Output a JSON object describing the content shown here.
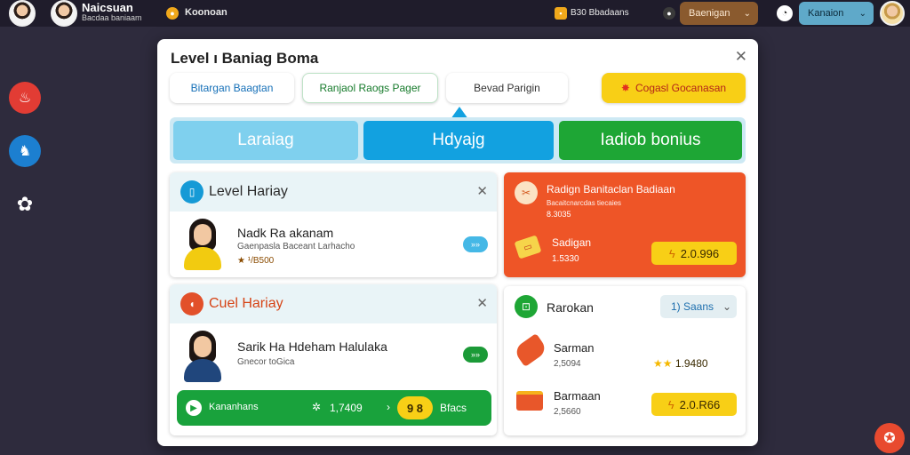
{
  "topbar": {
    "user_name": "Naicsuan",
    "user_sub": "Bacdaa baniaam",
    "app_label": "Koonoan",
    "currency_text": "B30 Bbadaans",
    "dropdown1_label": "Baenigan",
    "dropdown2_label": "Kanaion"
  },
  "modal": {
    "title": "Level ı Baniag Boma",
    "close_glyph": "✕",
    "pills": [
      "Bitargan Baagtan",
      "Ranjaol Raogs Pager",
      "Bevad Parigin",
      "Cogasl Gocanasan"
    ],
    "tabs": [
      "Laraiag",
      "Hdyajg",
      "Iadiob bonius"
    ]
  },
  "card1": {
    "title": "Level Hariay",
    "row_title": "Nadk Ra akanam",
    "row_sub": "Gaenpasla Baceant Larhacho",
    "rating": "★ ¹/B500",
    "go_label": "»»"
  },
  "card2": {
    "title": "Cuel Hariay",
    "row_title": "Sarik Ha Hdeham Halulaka",
    "row_sub": "Gnecor toGica",
    "go_label": "»»",
    "bar_left": "Kananhans",
    "bar_mid": "1,7409",
    "bar_right": "Bfacs",
    "bar_badge": "9 8"
  },
  "card3": {
    "title": "Radign Banitaclan Badiaan",
    "sub": "Bacaitcnarcdas tiecaies",
    "amount_small": "8.3035",
    "item_label": "Sadigan",
    "item_value": "1.5330",
    "button_label": "2.0.996"
  },
  "card4": {
    "title": "Rarokan",
    "dropdown_label": "1) Saans",
    "items": [
      {
        "name": "Sarman",
        "value": "2,5094",
        "rating": "1.9480"
      },
      {
        "name": "Barmaan",
        "value": "2,5660",
        "button": "2.0.R66"
      }
    ]
  }
}
